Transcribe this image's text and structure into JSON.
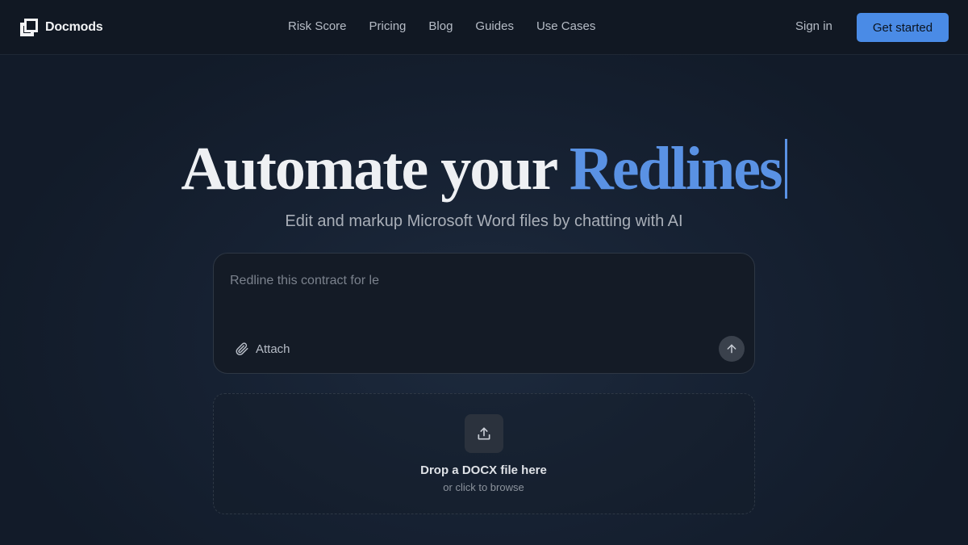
{
  "brand": {
    "name": "Docmods"
  },
  "nav": {
    "links": [
      "Risk Score",
      "Pricing",
      "Blog",
      "Guides",
      "Use Cases"
    ],
    "sign_in": "Sign in",
    "cta": "Get started"
  },
  "hero": {
    "title_prefix": "Automate your ",
    "title_accent": "Redlines",
    "subtitle": "Edit and markup Microsoft Word files by chatting with AI"
  },
  "prompt": {
    "value": "",
    "placeholder": "Redline this contract for le",
    "attach_label": "Attach"
  },
  "dropzone": {
    "title": "Drop a DOCX file here",
    "subtitle": "or click to browse"
  },
  "colors": {
    "accent": "#4a8be6",
    "background": "#162132",
    "navbar": "#111823"
  },
  "icons": {
    "logo": "docmods-logo-icon",
    "attach": "paperclip-icon",
    "send": "arrow-up-icon",
    "upload": "upload-icon"
  }
}
